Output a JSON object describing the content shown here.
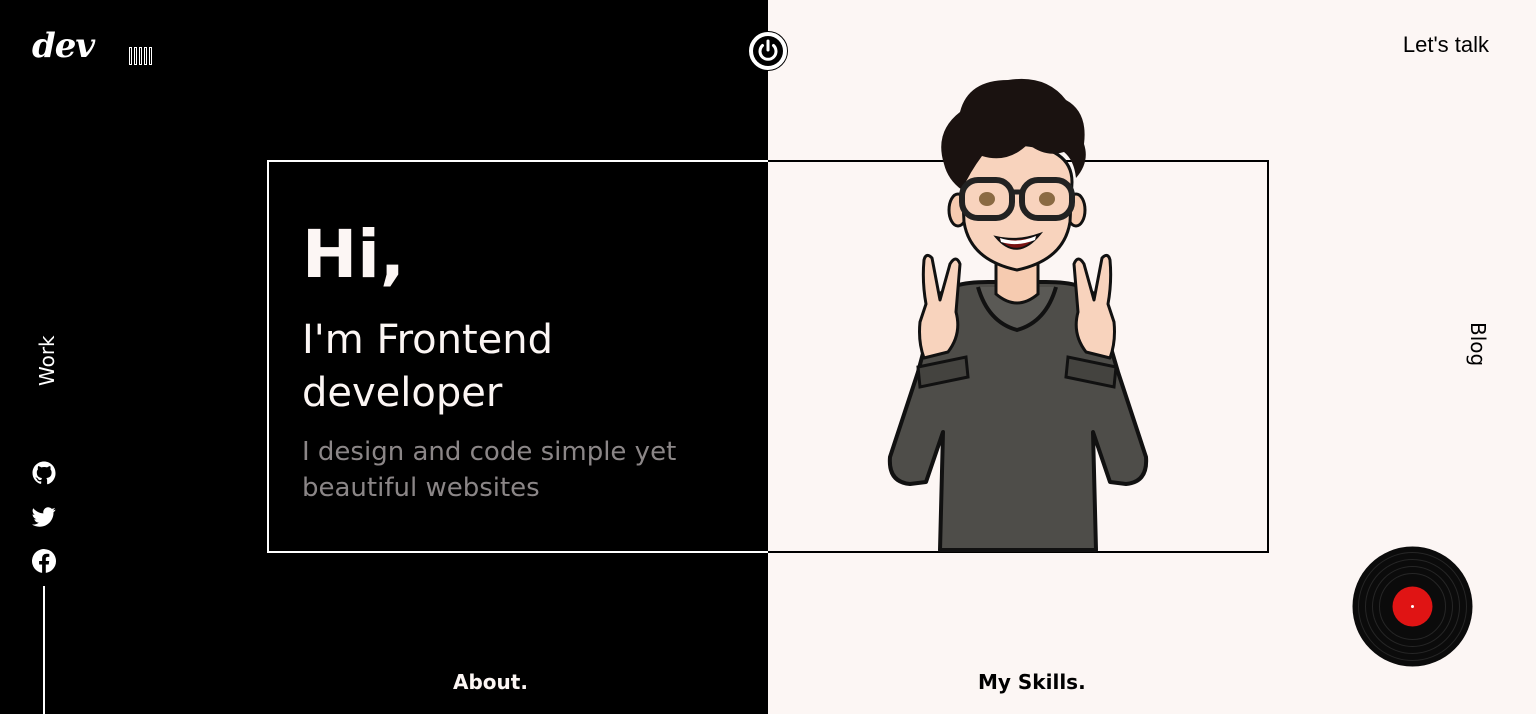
{
  "logo": {
    "text": "dev"
  },
  "header": {
    "contact_link": "Let's talk"
  },
  "nav": {
    "left_vertical": "Work",
    "right_vertical": "Blog",
    "bottom_left": "About.",
    "bottom_right": "My Skills."
  },
  "intro": {
    "greeting": "Hi,",
    "role": "I'm Frontend developer",
    "tagline": "I design and code simple yet beautiful websites"
  },
  "social": [
    "github-icon",
    "twitter-icon",
    "facebook-icon"
  ],
  "colors": {
    "dark": "#000000",
    "light": "#fcf6f4",
    "muted_text": "#8b8687",
    "record_label": "#e01414"
  }
}
